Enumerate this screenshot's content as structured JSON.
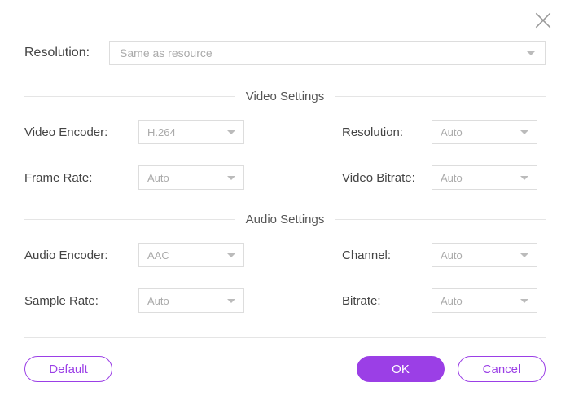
{
  "topResolution": {
    "label": "Resolution:",
    "value": "Same as resource"
  },
  "videoSection": {
    "title": "Video Settings",
    "rows": [
      {
        "leftLabel": "Video Encoder:",
        "leftValue": "H.264",
        "rightLabel": "Resolution:",
        "rightValue": "Auto"
      },
      {
        "leftLabel": "Frame Rate:",
        "leftValue": "Auto",
        "rightLabel": "Video Bitrate:",
        "rightValue": "Auto"
      }
    ]
  },
  "audioSection": {
    "title": "Audio Settings",
    "rows": [
      {
        "leftLabel": "Audio Encoder:",
        "leftValue": "AAC",
        "rightLabel": "Channel:",
        "rightValue": "Auto"
      },
      {
        "leftLabel": "Sample Rate:",
        "leftValue": "Auto",
        "rightLabel": "Bitrate:",
        "rightValue": "Auto"
      }
    ]
  },
  "buttons": {
    "default": "Default",
    "ok": "OK",
    "cancel": "Cancel"
  }
}
